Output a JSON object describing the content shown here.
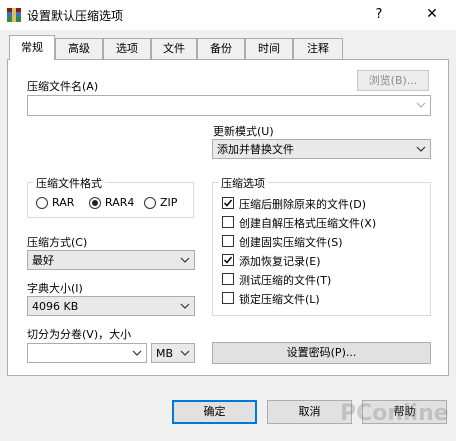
{
  "window": {
    "title": "设置默认压缩选项",
    "help": "?",
    "close": "✕",
    "icon": "winrar-icon"
  },
  "tabs": [
    {
      "label": "常规",
      "active": true
    },
    {
      "label": "高级"
    },
    {
      "label": "选项"
    },
    {
      "label": "文件"
    },
    {
      "label": "备份"
    },
    {
      "label": "时间"
    },
    {
      "label": "注释"
    }
  ],
  "archive": {
    "name_label": "压缩文件名(A)",
    "name_value": "",
    "browse_button": "浏览(B)..."
  },
  "update_mode": {
    "label": "更新模式(U)",
    "value": "添加并替换文件"
  },
  "format": {
    "group_label": "压缩文件格式",
    "options": [
      "RAR",
      "RAR4",
      "ZIP"
    ],
    "selected": "RAR4"
  },
  "method": {
    "label": "压缩方式(C)",
    "value": "最好"
  },
  "dictionary": {
    "label": "字典大小(I)",
    "value": "4096 KB"
  },
  "split": {
    "label": "切分为分卷(V)，大小",
    "value": "",
    "unit": "MB"
  },
  "options": {
    "group_label": "压缩选项",
    "items": [
      {
        "label": "压缩后删除原来的文件(D)",
        "checked": true
      },
      {
        "label": "创建自解压格式压缩文件(X)",
        "checked": false
      },
      {
        "label": "创建固实压缩文件(S)",
        "checked": false
      },
      {
        "label": "添加恢复记录(E)",
        "checked": true
      },
      {
        "label": "测试压缩的文件(T)",
        "checked": false
      },
      {
        "label": "锁定压缩文件(L)",
        "checked": false
      }
    ]
  },
  "password_button": "设置密码(P)...",
  "footer": {
    "ok": "确定",
    "cancel": "取消",
    "help": "帮助"
  },
  "watermark": {
    "text": "PConline"
  }
}
